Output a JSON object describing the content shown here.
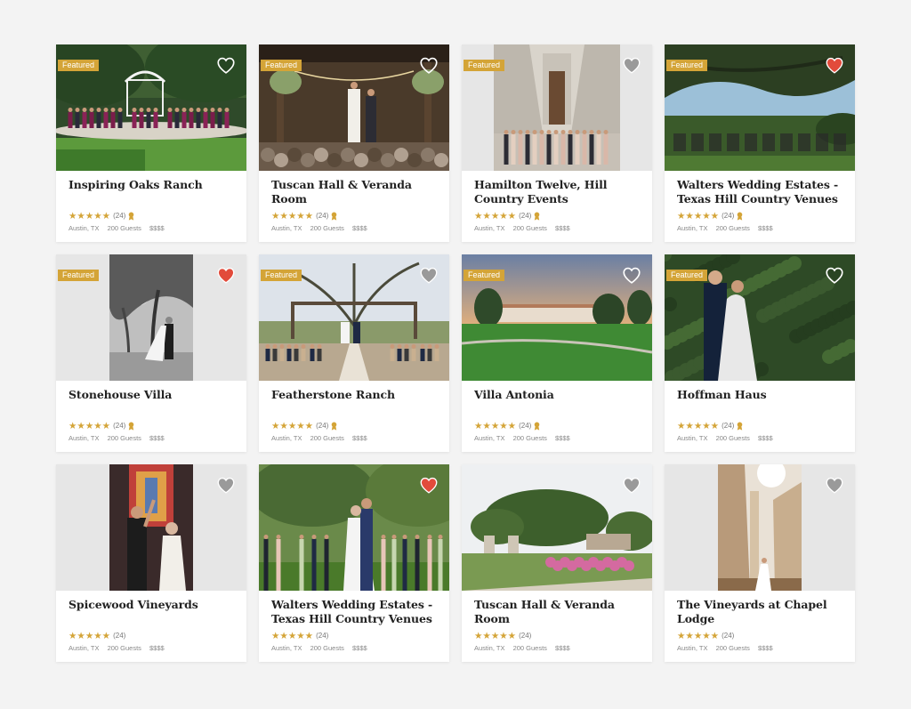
{
  "colors": {
    "background": "#f3f3f3",
    "badge": "#d4a437",
    "star": "#d4a437",
    "heart_active": "#e24b3b",
    "heart_inactive_on_light": "#9a9a9a",
    "heart_outline_on_photo": "#ffffff"
  },
  "icons": {
    "heart": "heart-icon",
    "star": "star-icon",
    "award": "award-ribbon-icon"
  },
  "venues": [
    {
      "title": "Inspiring Oaks Ranch",
      "featured": true,
      "badge": "Featured",
      "favorited": false,
      "heart_style": "outline-white",
      "stars": "★★★★★",
      "count": "(24)",
      "award": true,
      "location": "Austin, TX",
      "guests": "200 Guests",
      "price": "$$$$",
      "scene": "oaks",
      "layout": "full"
    },
    {
      "title": "Tuscan Hall & Veranda Room",
      "featured": true,
      "badge": "Featured",
      "favorited": false,
      "heart_style": "outline-white",
      "stars": "★★★★★",
      "count": "(24)",
      "award": true,
      "location": "Austin, TX",
      "guests": "200 Guests",
      "price": "$$$$",
      "scene": "tuscan",
      "layout": "full"
    },
    {
      "title": "Hamilton Twelve, Hill Country Events",
      "featured": true,
      "badge": "Featured",
      "favorited": false,
      "heart_style": "filled-gray",
      "stars": "★★★★★",
      "count": "(24)",
      "award": true,
      "location": "Austin, TX",
      "guests": "200 Guests",
      "price": "$$$$",
      "scene": "hamilton",
      "layout": "letter"
    },
    {
      "title": "Walters Wedding Estates - Texas Hill Country Venues",
      "featured": true,
      "badge": "Featured",
      "favorited": true,
      "heart_style": "filled-red",
      "stars": "★★★★★",
      "count": "(24)",
      "award": true,
      "location": "Austin, TX",
      "guests": "200 Guests",
      "price": "$$$$",
      "scene": "walters",
      "layout": "full"
    },
    {
      "title": "Stonehouse Villa",
      "featured": true,
      "badge": "Featured",
      "favorited": true,
      "heart_style": "filled-red",
      "stars": "★★★★★",
      "count": "(24)",
      "award": true,
      "location": "Austin, TX",
      "guests": "200 Guests",
      "price": "$$$$",
      "scene": "stonehouse",
      "layout": "letter"
    },
    {
      "title": "Featherstone Ranch",
      "featured": true,
      "badge": "Featured",
      "favorited": false,
      "heart_style": "filled-gray",
      "stars": "★★★★★",
      "count": "(24)",
      "award": true,
      "location": "Austin, TX",
      "guests": "200 Guests",
      "price": "$$$$",
      "scene": "featherstone",
      "layout": "full"
    },
    {
      "title": "Villa Antonia",
      "featured": true,
      "badge": "Featured",
      "favorited": false,
      "heart_style": "outline-white",
      "stars": "★★★★★",
      "count": "(24)",
      "award": true,
      "location": "Austin, TX",
      "guests": "200 Guests",
      "price": "$$$$",
      "scene": "antonia",
      "layout": "full"
    },
    {
      "title": "Hoffman Haus",
      "featured": true,
      "badge": "Featured",
      "favorited": false,
      "heart_style": "outline-white",
      "stars": "★★★★★",
      "count": "(24)",
      "award": true,
      "location": "Austin, TX",
      "guests": "200 Guests",
      "price": "$$$$",
      "scene": "hoffman",
      "layout": "full"
    },
    {
      "title": "Spicewood Vineyards",
      "featured": false,
      "badge": "",
      "favorited": false,
      "heart_style": "filled-gray",
      "stars": "★★★★★",
      "count": "(24)",
      "award": false,
      "location": "Austin, TX",
      "guests": "200 Guests",
      "price": "$$$$",
      "scene": "spicewood",
      "layout": "letter"
    },
    {
      "title": "Walters Wedding Estates - Texas Hill Country Venues",
      "featured": false,
      "badge": "",
      "favorited": true,
      "heart_style": "filled-red",
      "stars": "★★★★★",
      "count": "(24)",
      "award": false,
      "location": "Austin, TX",
      "guests": "200 Guests",
      "price": "$$$$",
      "scene": "walters2",
      "layout": "full"
    },
    {
      "title": "Tuscan Hall & Veranda Room",
      "featured": false,
      "badge": "",
      "favorited": false,
      "heart_style": "filled-gray",
      "stars": "★★★★★",
      "count": "(24)",
      "award": false,
      "location": "Austin, TX",
      "guests": "200 Guests",
      "price": "$$$$",
      "scene": "tuscan2",
      "layout": "full"
    },
    {
      "title": "The Vineyards at Chapel Lodge",
      "featured": false,
      "badge": "",
      "favorited": false,
      "heart_style": "filled-gray",
      "stars": "★★★★★",
      "count": "(24)",
      "award": false,
      "location": "Austin, TX",
      "guests": "200 Guests",
      "price": "$$$$",
      "scene": "chapel",
      "layout": "letter"
    }
  ]
}
